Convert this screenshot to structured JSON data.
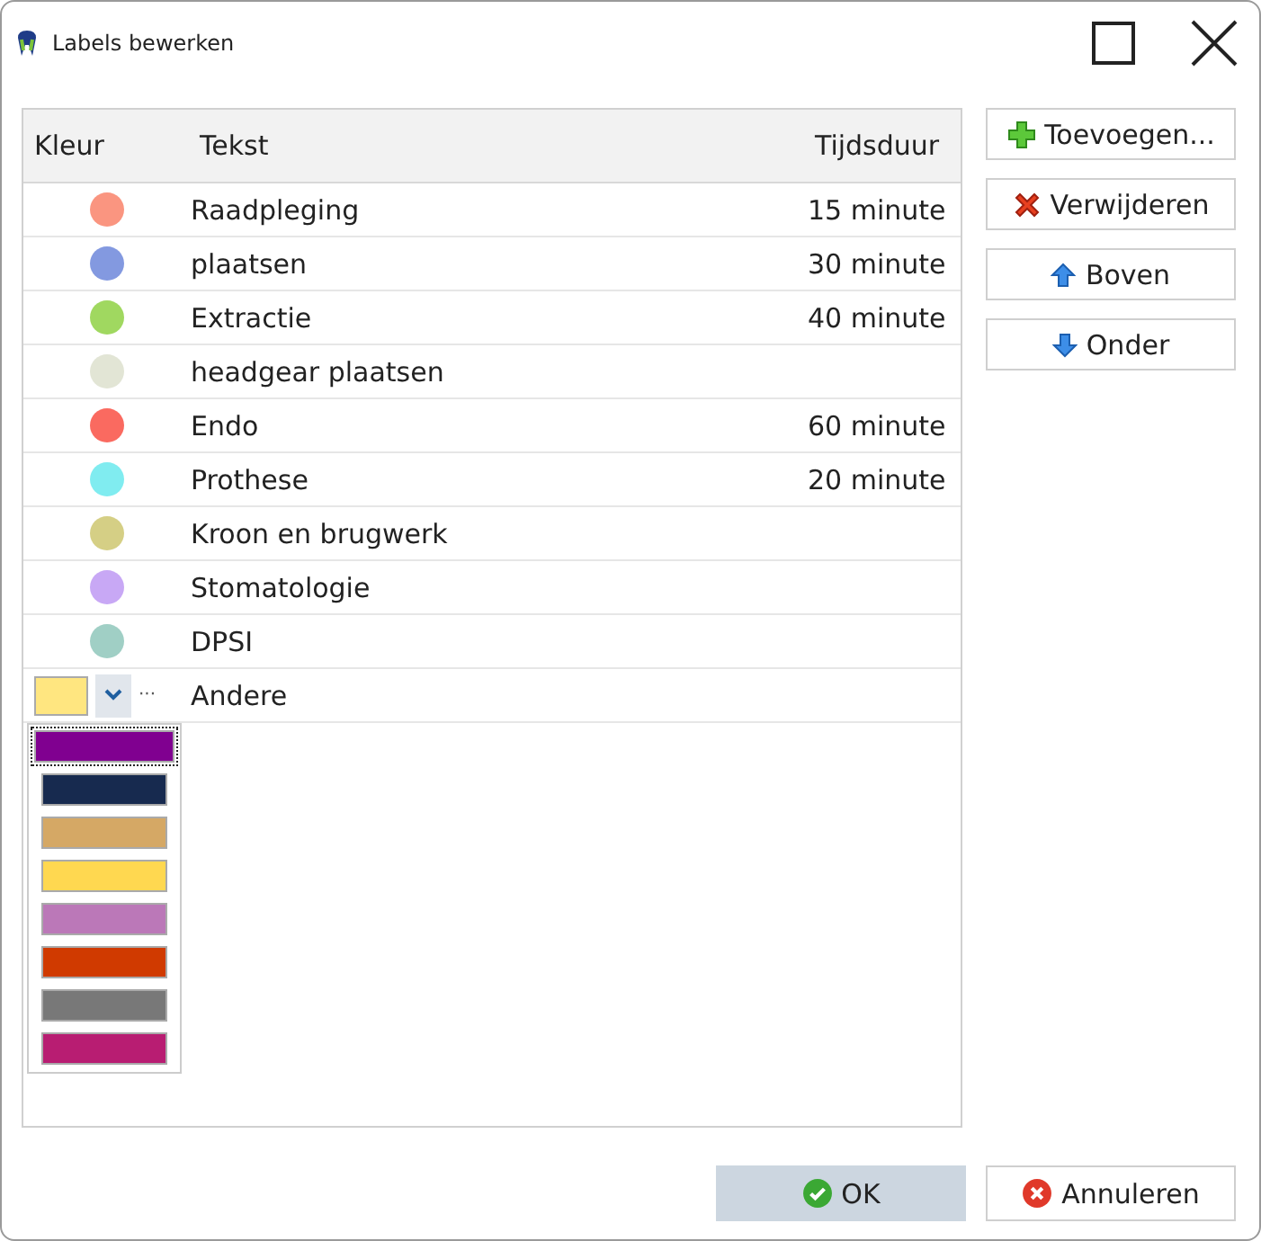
{
  "window": {
    "title": "Labels bewerken"
  },
  "table": {
    "columns": [
      "Kleur",
      "Tekst",
      "Tijdsduur"
    ],
    "rows": [
      {
        "kind": "dot",
        "color": "#fa9580",
        "text": "Raadpleging",
        "duration": "15 minute"
      },
      {
        "kind": "dot",
        "color": "#8399e0",
        "text": "plaatsen",
        "duration": "30 minute"
      },
      {
        "kind": "dot",
        "color": "#a0d860",
        "text": "Extractie",
        "duration": "40 minute"
      },
      {
        "kind": "dot",
        "color": "#e2e5d5",
        "text": "headgear plaatsen"
      },
      {
        "kind": "dot",
        "color": "#fa6a60",
        "text": "Endo",
        "duration": "60 minute"
      },
      {
        "kind": "dot",
        "color": "#80ecf0",
        "text": "Prothese",
        "duration": "20 minute"
      },
      {
        "kind": "dot",
        "color": "#d5cf85",
        "text": "Kroon en brugwerk"
      },
      {
        "kind": "dot",
        "color": "#c8a8f5",
        "text": "Stomatologie"
      },
      {
        "kind": "dot",
        "color": "#a0cfc5",
        "text": "DPSI"
      },
      {
        "kind": "editor",
        "color": "#ffe680",
        "ellipsis": "···",
        "text": "Andere"
      }
    ],
    "palette": [
      {
        "color": "#800090",
        "selected": true
      },
      {
        "color": "#172a4f",
        "selected": false
      },
      {
        "color": "#d5a865",
        "selected": false
      },
      {
        "color": "#ffd850",
        "selected": false
      },
      {
        "color": "#bb78b8",
        "selected": false
      },
      {
        "color": "#d03a00",
        "selected": false
      },
      {
        "color": "#787878",
        "selected": false
      },
      {
        "color": "#b81d72",
        "selected": false
      }
    ]
  },
  "side_buttons": [
    {
      "kind": "add",
      "label": "Toevoegen..."
    },
    {
      "kind": "delete",
      "label": "Verwijderen"
    },
    {
      "kind": "up",
      "label": "Boven"
    },
    {
      "kind": "down",
      "label": "Onder"
    }
  ],
  "footer_buttons": [
    {
      "kind": "ok",
      "label": "OK",
      "selected": true
    },
    {
      "kind": "cancel",
      "label": "Annuleren",
      "selected": false
    }
  ]
}
